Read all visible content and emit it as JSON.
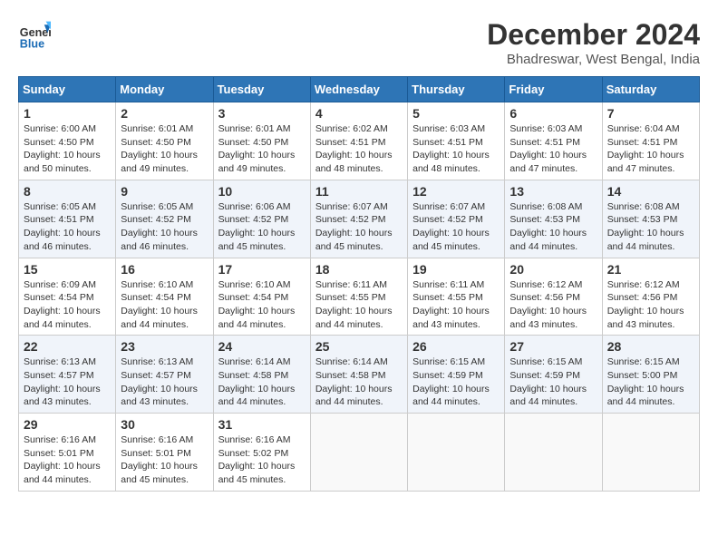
{
  "header": {
    "logo_line1": "General",
    "logo_line2": "Blue",
    "month": "December 2024",
    "location": "Bhadreswar, West Bengal, India"
  },
  "weekdays": [
    "Sunday",
    "Monday",
    "Tuesday",
    "Wednesday",
    "Thursday",
    "Friday",
    "Saturday"
  ],
  "weeks": [
    [
      {
        "day": "1",
        "info": "Sunrise: 6:00 AM\nSunset: 4:50 PM\nDaylight: 10 hours\nand 50 minutes."
      },
      {
        "day": "2",
        "info": "Sunrise: 6:01 AM\nSunset: 4:50 PM\nDaylight: 10 hours\nand 49 minutes."
      },
      {
        "day": "3",
        "info": "Sunrise: 6:01 AM\nSunset: 4:50 PM\nDaylight: 10 hours\nand 49 minutes."
      },
      {
        "day": "4",
        "info": "Sunrise: 6:02 AM\nSunset: 4:51 PM\nDaylight: 10 hours\nand 48 minutes."
      },
      {
        "day": "5",
        "info": "Sunrise: 6:03 AM\nSunset: 4:51 PM\nDaylight: 10 hours\nand 48 minutes."
      },
      {
        "day": "6",
        "info": "Sunrise: 6:03 AM\nSunset: 4:51 PM\nDaylight: 10 hours\nand 47 minutes."
      },
      {
        "day": "7",
        "info": "Sunrise: 6:04 AM\nSunset: 4:51 PM\nDaylight: 10 hours\nand 47 minutes."
      }
    ],
    [
      {
        "day": "8",
        "info": "Sunrise: 6:05 AM\nSunset: 4:51 PM\nDaylight: 10 hours\nand 46 minutes."
      },
      {
        "day": "9",
        "info": "Sunrise: 6:05 AM\nSunset: 4:52 PM\nDaylight: 10 hours\nand 46 minutes."
      },
      {
        "day": "10",
        "info": "Sunrise: 6:06 AM\nSunset: 4:52 PM\nDaylight: 10 hours\nand 45 minutes."
      },
      {
        "day": "11",
        "info": "Sunrise: 6:07 AM\nSunset: 4:52 PM\nDaylight: 10 hours\nand 45 minutes."
      },
      {
        "day": "12",
        "info": "Sunrise: 6:07 AM\nSunset: 4:52 PM\nDaylight: 10 hours\nand 45 minutes."
      },
      {
        "day": "13",
        "info": "Sunrise: 6:08 AM\nSunset: 4:53 PM\nDaylight: 10 hours\nand 44 minutes."
      },
      {
        "day": "14",
        "info": "Sunrise: 6:08 AM\nSunset: 4:53 PM\nDaylight: 10 hours\nand 44 minutes."
      }
    ],
    [
      {
        "day": "15",
        "info": "Sunrise: 6:09 AM\nSunset: 4:54 PM\nDaylight: 10 hours\nand 44 minutes."
      },
      {
        "day": "16",
        "info": "Sunrise: 6:10 AM\nSunset: 4:54 PM\nDaylight: 10 hours\nand 44 minutes."
      },
      {
        "day": "17",
        "info": "Sunrise: 6:10 AM\nSunset: 4:54 PM\nDaylight: 10 hours\nand 44 minutes."
      },
      {
        "day": "18",
        "info": "Sunrise: 6:11 AM\nSunset: 4:55 PM\nDaylight: 10 hours\nand 44 minutes."
      },
      {
        "day": "19",
        "info": "Sunrise: 6:11 AM\nSunset: 4:55 PM\nDaylight: 10 hours\nand 43 minutes."
      },
      {
        "day": "20",
        "info": "Sunrise: 6:12 AM\nSunset: 4:56 PM\nDaylight: 10 hours\nand 43 minutes."
      },
      {
        "day": "21",
        "info": "Sunrise: 6:12 AM\nSunset: 4:56 PM\nDaylight: 10 hours\nand 43 minutes."
      }
    ],
    [
      {
        "day": "22",
        "info": "Sunrise: 6:13 AM\nSunset: 4:57 PM\nDaylight: 10 hours\nand 43 minutes."
      },
      {
        "day": "23",
        "info": "Sunrise: 6:13 AM\nSunset: 4:57 PM\nDaylight: 10 hours\nand 43 minutes."
      },
      {
        "day": "24",
        "info": "Sunrise: 6:14 AM\nSunset: 4:58 PM\nDaylight: 10 hours\nand 44 minutes."
      },
      {
        "day": "25",
        "info": "Sunrise: 6:14 AM\nSunset: 4:58 PM\nDaylight: 10 hours\nand 44 minutes."
      },
      {
        "day": "26",
        "info": "Sunrise: 6:15 AM\nSunset: 4:59 PM\nDaylight: 10 hours\nand 44 minutes."
      },
      {
        "day": "27",
        "info": "Sunrise: 6:15 AM\nSunset: 4:59 PM\nDaylight: 10 hours\nand 44 minutes."
      },
      {
        "day": "28",
        "info": "Sunrise: 6:15 AM\nSunset: 5:00 PM\nDaylight: 10 hours\nand 44 minutes."
      }
    ],
    [
      {
        "day": "29",
        "info": "Sunrise: 6:16 AM\nSunset: 5:01 PM\nDaylight: 10 hours\nand 44 minutes."
      },
      {
        "day": "30",
        "info": "Sunrise: 6:16 AM\nSunset: 5:01 PM\nDaylight: 10 hours\nand 45 minutes."
      },
      {
        "day": "31",
        "info": "Sunrise: 6:16 AM\nSunset: 5:02 PM\nDaylight: 10 hours\nand 45 minutes."
      },
      null,
      null,
      null,
      null
    ]
  ]
}
